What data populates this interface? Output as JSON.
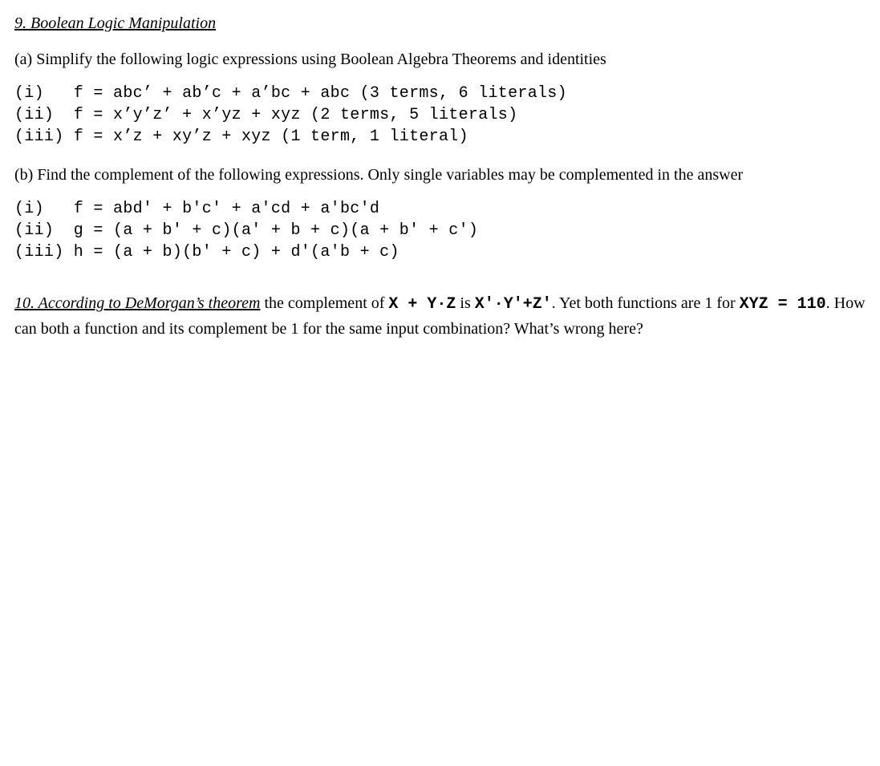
{
  "q9": {
    "title": "9. Boolean Logic Manipulation",
    "partA": {
      "prompt": "(a) Simplify the following logic expressions using Boolean Algebra Theorems and identities",
      "items": "(i)   f = abc’ + ab’c + a’bc + abc (3 terms, 6 literals)\n(ii)  f = x’y’z’ + x’yz + xyz (2 terms, 5 literals)\n(iii) f = x’z + xy’z + xyz (1 term, 1 literal)"
    },
    "partB": {
      "prompt": "(b) Find the complement of the following expressions. Only single variables may be complemented in the answer",
      "items": "(i)   f = abd' + b'c' + a'cd + a'bc'd\n(ii)  g = (a + b' + c)(a' + b + c)(a + b' + c')\n(iii) h = (a + b)(b' + c) + d'(a'b + c)"
    }
  },
  "q10": {
    "titlePrefix": "10. According to DeMorgan’s theorem",
    "seg1": " the complement of ",
    "expr1": "X + Y·Z",
    "seg2": " is ",
    "expr2": "X'·Y'+Z'",
    "seg3": ". Yet both functions are 1 for ",
    "expr3": "XYZ = 110",
    "seg4": ". How can both a function and its complement be 1 for the same input combination? What’s wrong here?"
  }
}
